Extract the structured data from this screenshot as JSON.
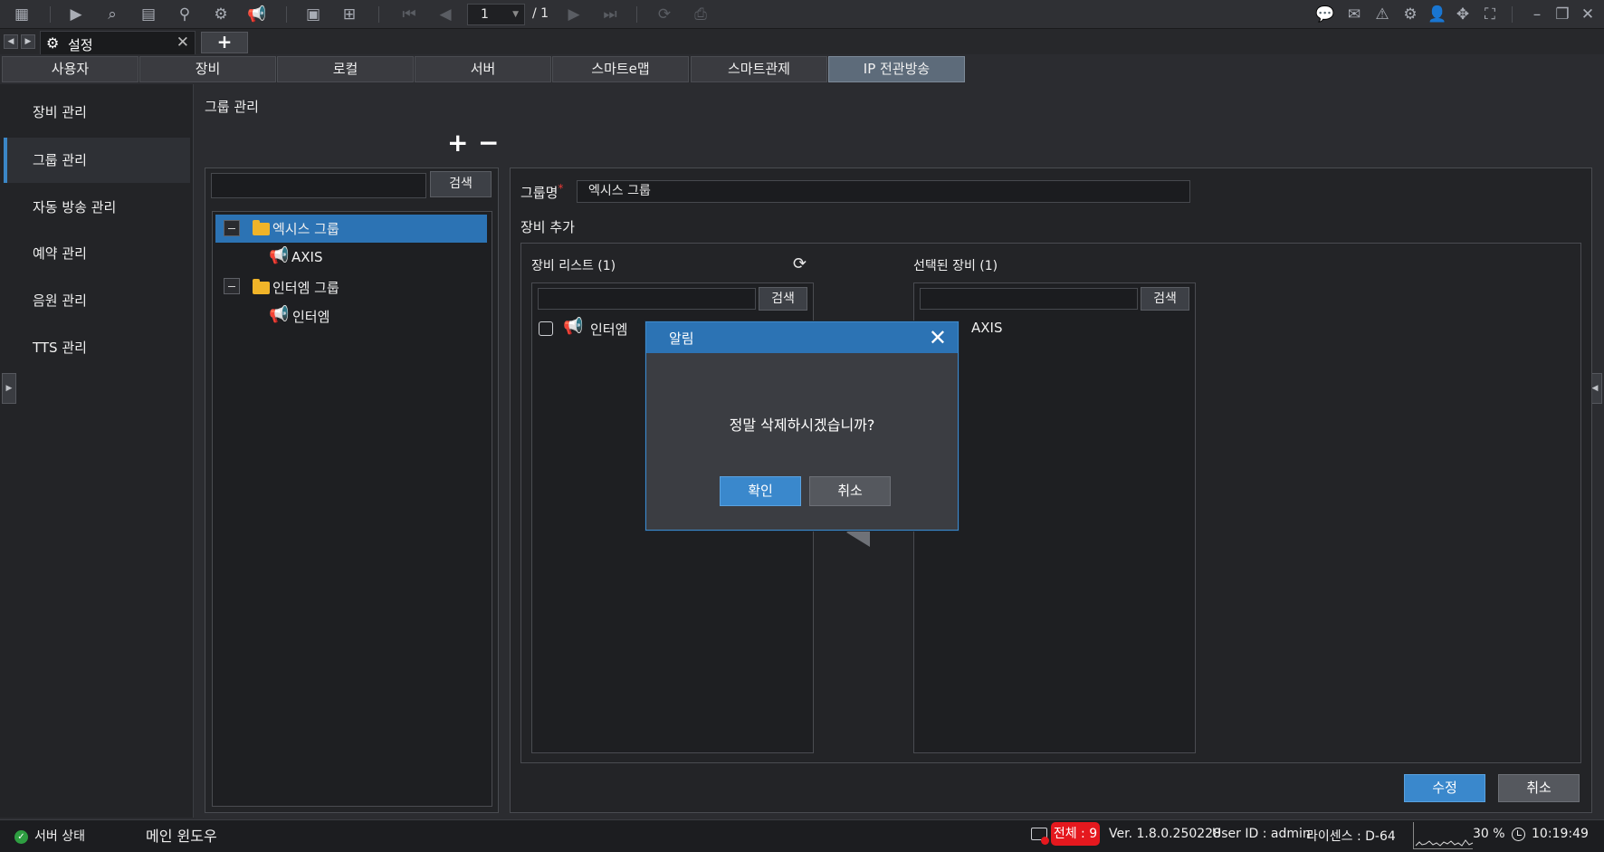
{
  "toolbar": {
    "page_current": "1",
    "page_total": "/ 1"
  },
  "window_tab": {
    "label": "설정"
  },
  "main_tabs": [
    "사용자",
    "장비",
    "로컬",
    "서버",
    "스마트e맵",
    "스마트관제",
    "IP 전관방송"
  ],
  "left_menu": [
    "장비 관리",
    "그룹 관리",
    "자동 방송 관리",
    "예약 관리",
    "음원 관리",
    "TTS 관리"
  ],
  "section_title": "그룹 관리",
  "group_tree": {
    "search_button": "검색",
    "groups": [
      {
        "name": "엑시스 그룹",
        "device": "AXIS"
      },
      {
        "name": "인터엠 그룹",
        "device": "인터엠"
      }
    ]
  },
  "form": {
    "group_name_label": "그룹명",
    "required_mark": "*",
    "group_name_value": "엑시스 그룹",
    "add_device_label": "장비 추가",
    "device_list_label": "장비 리스트 (1)",
    "device_list_search": "검색",
    "device_list_items": [
      "인터엠"
    ],
    "selected_label": "선택된 장비 (1)",
    "selected_search": "검색",
    "selected_items": [
      "AXIS"
    ],
    "modify_button": "수정",
    "cancel_button": "취소"
  },
  "dialog": {
    "title": "알림",
    "message": "정말 삭제하시겠습니까?",
    "ok": "확인",
    "cancel": "취소"
  },
  "status_bar": {
    "server_status": "서버 상태",
    "main_window": "메인 윈도우",
    "total": "전체 : 9",
    "version": "Ver. 1.8.0.250228",
    "user": "User ID : admin",
    "license": "라이센스 : D-64",
    "cpu": "30 %",
    "time": "10:19:49"
  },
  "colors": {
    "accent_blue": "#3a88cc",
    "dialog_header": "#2c73b4",
    "alert_red": "#e5181e",
    "folder": "#f0b429"
  }
}
